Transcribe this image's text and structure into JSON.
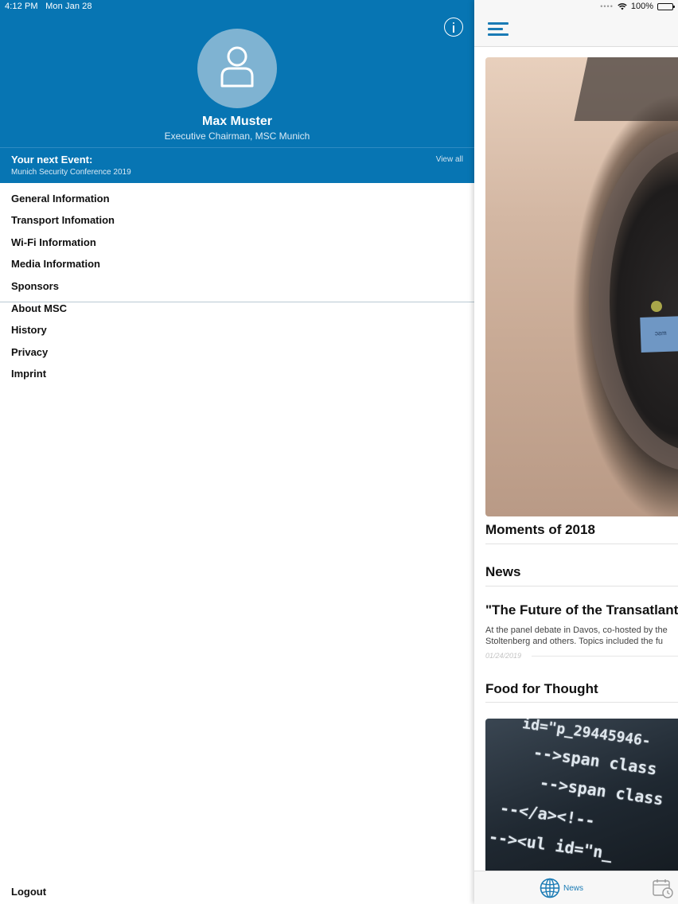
{
  "status_bar": {
    "time": "4:12 PM",
    "date": "Mon Jan 28",
    "battery": "100%"
  },
  "profile": {
    "name": "Max Muster",
    "role": "Executive Chairman, MSC Munich"
  },
  "next_event": {
    "label": "Your next Event:",
    "name": "Munich Security Conference 2019",
    "view_all": "View all"
  },
  "menu": {
    "section_one": [
      {
        "label": "General Information"
      },
      {
        "label": "Transport Infomation"
      },
      {
        "label": "Wi-Fi Information"
      },
      {
        "label": "Media Information"
      },
      {
        "label": "Sponsors"
      }
    ],
    "section_two": [
      {
        "label": "About MSC"
      },
      {
        "label": "History"
      },
      {
        "label": "Privacy"
      },
      {
        "label": "Imprint"
      }
    ],
    "logout": "Logout"
  },
  "content": {
    "hero_title": "Moments of 2018",
    "hero_card_text": "msc",
    "news_heading": "News",
    "article": {
      "title": "\"The Future of the Transatlantic",
      "excerpt_line1": "At the panel debate in Davos, co-hosted by the",
      "excerpt_line2": "Stoltenberg and others. Topics included the fu",
      "date": "01/24/2019"
    },
    "food_heading": "Food for Thought",
    "code_lines": [
      "id=\"p_29445946-",
      "-->span class",
      "-->span class",
      "--</a><!--",
      "--><ul id=\"n_"
    ]
  },
  "tab_bar": {
    "news_label": "News"
  },
  "colors": {
    "brand_blue": "#0775b3",
    "accent_blue": "#1a7bb5"
  },
  "icons": [
    "info-icon",
    "user-icon",
    "hamburger-menu-icon",
    "wifi-icon",
    "battery-icon",
    "globe-icon",
    "calendar-clock-icon"
  ]
}
